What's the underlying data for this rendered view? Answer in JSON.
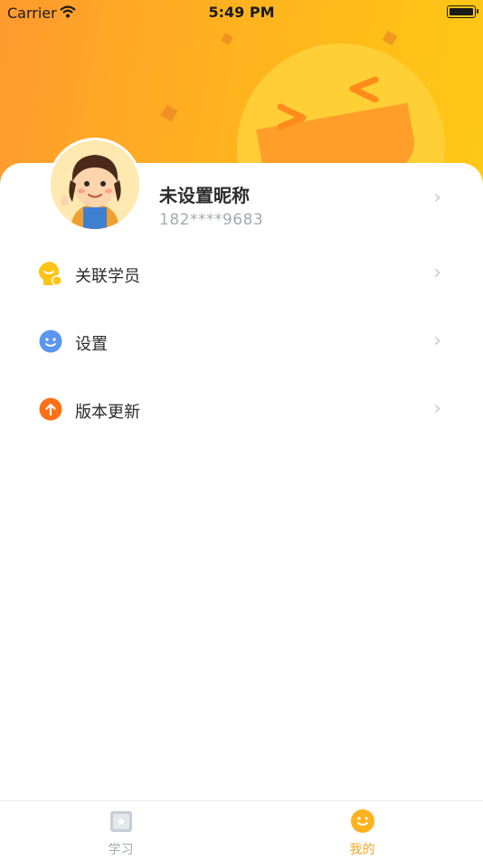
{
  "status_bar": {
    "carrier": "Carrier",
    "time": "5:49 PM"
  },
  "profile": {
    "nickname": "未设置昵称",
    "phone": "182****9683"
  },
  "menu": {
    "items": [
      {
        "label": "关联学员",
        "icon": "link-student-icon"
      },
      {
        "label": "设置",
        "icon": "settings-icon"
      },
      {
        "label": "版本更新",
        "icon": "update-icon"
      }
    ]
  },
  "tabbar": {
    "tabs": [
      {
        "label": "学习",
        "active": false
      },
      {
        "label": "我的",
        "active": true
      }
    ]
  },
  "colors": {
    "accent": "#ffb21f",
    "tab_active": "#f5a623",
    "tab_inactive": "#a5a9b0"
  }
}
